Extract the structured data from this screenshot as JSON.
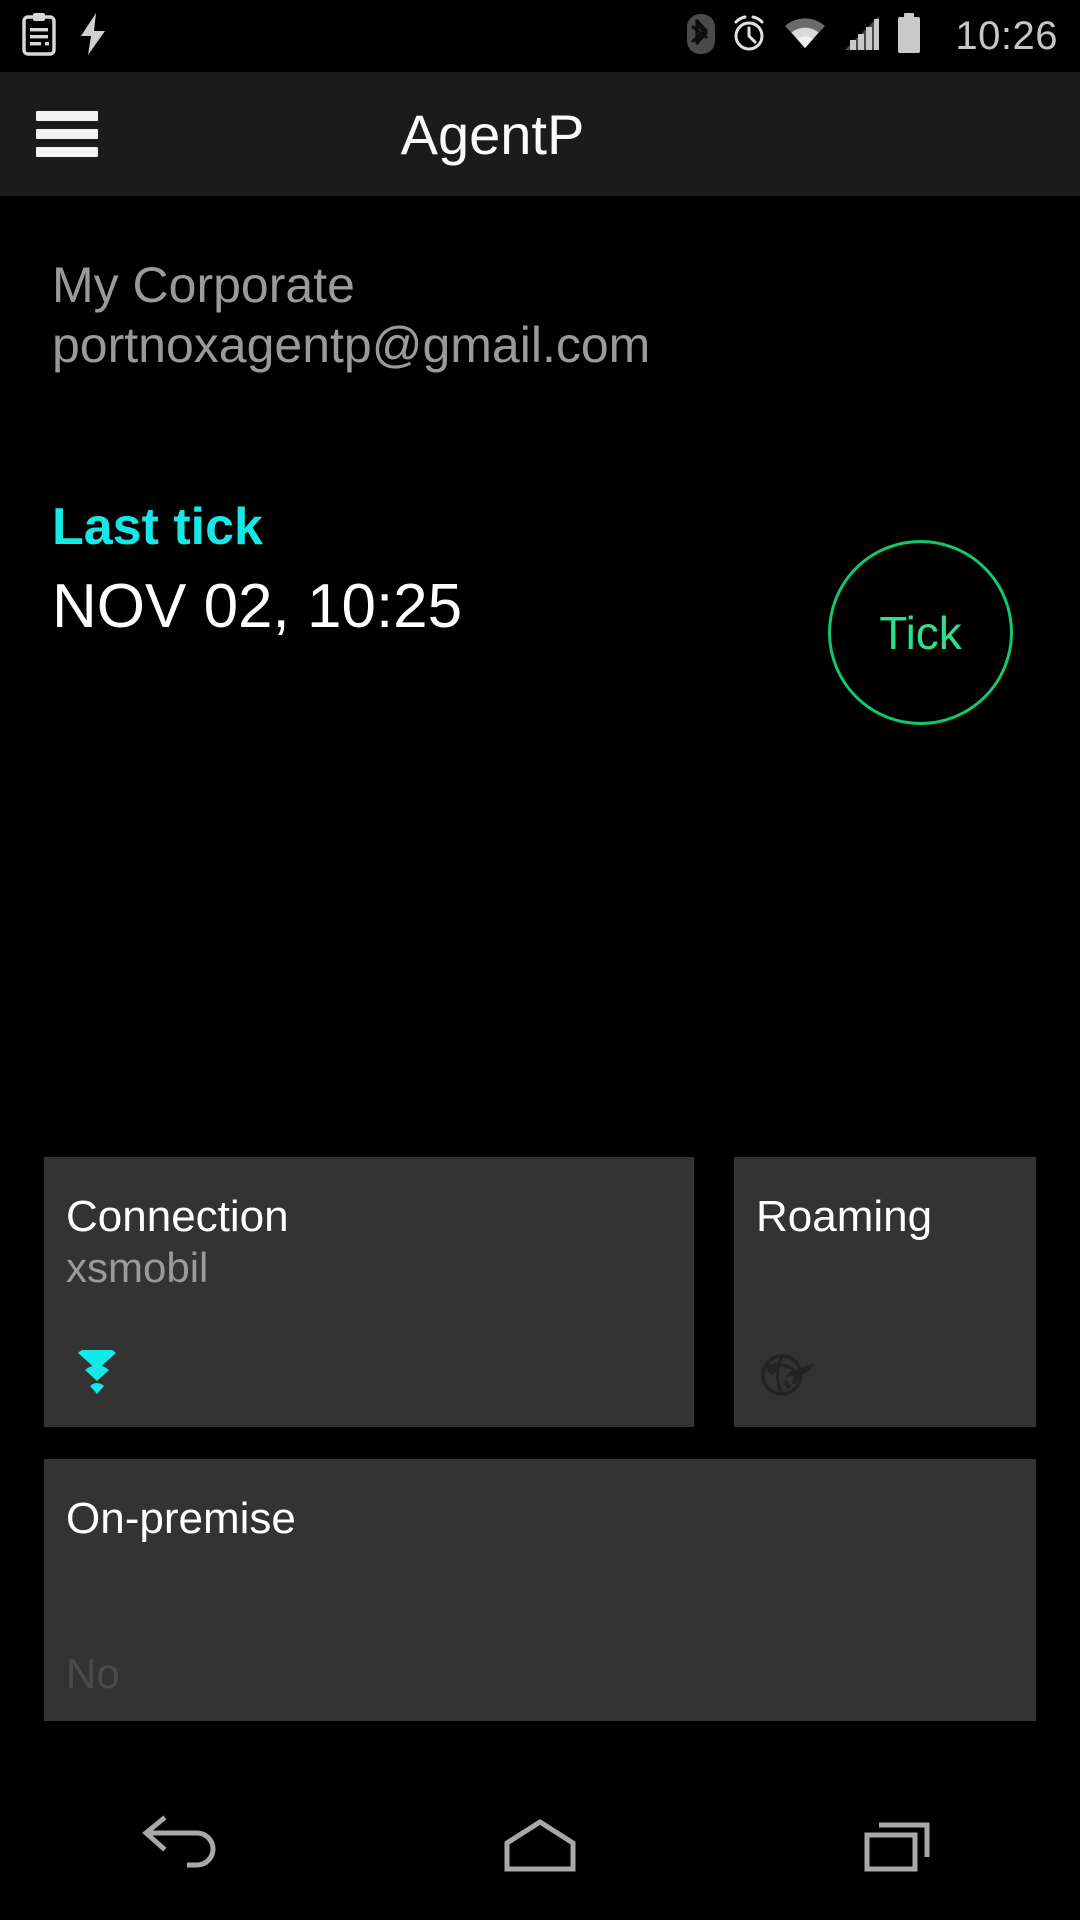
{
  "statusbar": {
    "time": "10:26",
    "left_icons": [
      {
        "name": "clipboard-icon"
      },
      {
        "name": "lightning-bolt-icon"
      }
    ],
    "right_icons": [
      {
        "name": "bluetooth-icon"
      },
      {
        "name": "alarm-clock-icon"
      },
      {
        "name": "wifi-icon"
      },
      {
        "name": "cellular-signal-icon"
      },
      {
        "name": "battery-icon"
      }
    ]
  },
  "appbar": {
    "title": "AgentP",
    "menu_icon": "hamburger-menu-icon"
  },
  "account": {
    "name": "My Corporate",
    "email": "portnoxagentp@gmail.com"
  },
  "last_tick": {
    "label": "Last tick",
    "value": "NOV 02, 10:25"
  },
  "tick_button": {
    "label": "Tick",
    "color": "#11c96b"
  },
  "cards": [
    {
      "id": "connection",
      "title": "Connection",
      "value": "xsmobil",
      "icon": "wifi-icon",
      "icon_color": "#16E8E8",
      "icon_active": true
    },
    {
      "id": "roaming",
      "title": "Roaming",
      "value": "",
      "icon": "globe-airplane-roaming-icon",
      "icon_color": "#1f1f1f",
      "icon_active": false
    },
    {
      "id": "onpremise",
      "title": "On-premise",
      "value": "No",
      "icon": "",
      "icon_color": "",
      "icon_active": false
    }
  ],
  "navbar": {
    "back_label": "back-icon",
    "home_label": "home-icon",
    "recents_label": "recents-icon"
  },
  "colors": {
    "background": "#000000",
    "appbar": "#1b1b1b",
    "card": "#333333",
    "accent_cyan": "#16E8E8",
    "accent_green": "#11c96b",
    "text_primary": "#ffffff",
    "text_secondary": "#9a9a9a",
    "text_muted": "#4a4a4a"
  }
}
